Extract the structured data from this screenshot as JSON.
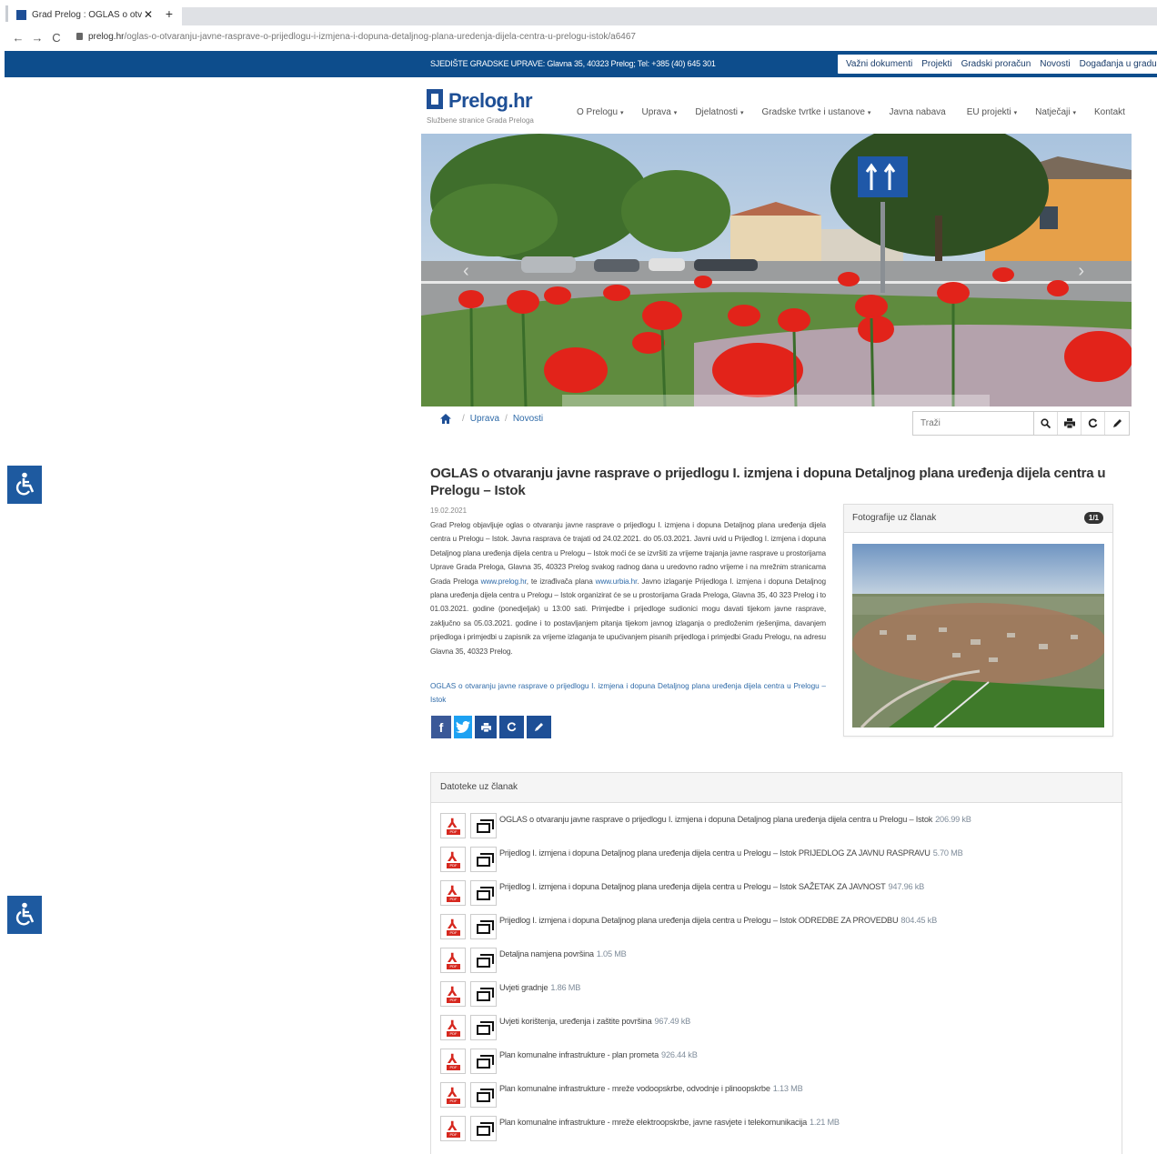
{
  "browser": {
    "tab_title": "Grad Prelog : OGLAS o otvaranju",
    "tab_close": "✕",
    "new_tab": "+",
    "url_host": "prelog.hr",
    "url_path": "/oglas-o-otvaranju-javne-rasprave-o-prijedlogu-i-izmjena-i-dopuna-detaljnog-plana-uredenja-dijela-centra-u-prelogu-istok/a6467"
  },
  "topbar": {
    "seat": "SJEDIŠTE GRADSKE UPRAVE: Glavna 35, 40323 Prelog; Tel: +385 (40) 645 301",
    "links": [
      "Važni dokumenti",
      "Projekti",
      "Gradski proračun",
      "Novosti",
      "Događanja u gradu"
    ]
  },
  "logo": {
    "name": "Prelog.hr",
    "subtitle": "Službene stranice Grada Preloga"
  },
  "nav": [
    {
      "label": "O Prelogu",
      "caret": "▾"
    },
    {
      "label": "Uprava",
      "caret": "▾"
    },
    {
      "label": "Djelatnosti",
      "caret": "▾"
    },
    {
      "label": "Gradske tvrtke i ustanove",
      "caret": "▾"
    },
    {
      "label": "Javna nabava",
      "caret": ""
    },
    {
      "label": "EU projekti",
      "caret": "▾"
    },
    {
      "label": "Natječaji",
      "caret": "▾"
    },
    {
      "label": "Kontakt",
      "caret": ""
    }
  ],
  "breadcrumb": [
    "Uprava",
    "Novosti"
  ],
  "search": {
    "placeholder": "Traži"
  },
  "article": {
    "title": "OGLAS o otvaranju javne rasprave o prijedlogu I. izmjena i dopuna Detaljnog plana uređenja dijela centra u Prelogu – Istok",
    "date": "19.02.2021",
    "body_1": "Grad Prelog objavljuje oglas o otvaranju javne rasprave o prijedlogu I. izmjena i dopuna Detaljnog plana uređenja dijela centra u Prelogu – Istok. Javna rasprava će trajati od 24.02.2021. do 05.03.2021. Javni uvid u Prijedlog I. izmjena i dopuna Detaljnog plana uređenja dijela centra u Prelogu – Istok moći će se izvršiti za vrijeme trajanja javne rasprave u prostorijama Uprave Grada Preloga, Glavna 35, 40323 Prelog svakog radnog dana u uredovno radno vrijeme i na mrežnim stranicama Grada Preloga ",
    "link_1": "www.prelog.hr",
    "body_2": ", te izrađivača plana ",
    "link_2": "www.urbia.hr",
    "body_3": ". Javno izlaganje Prijedloga I. izmjena i dopuna Detaljnog plana uređenja dijela centra u Prelogu – Istok organizirat će se u prostorijama Grada Preloga, Glavna 35, 40 323 Prelog i to 01.03.2021. godine (ponedjeljak) u 13:00 sati. Primjedbe i prijedloge sudionici mogu davati tijekom javne rasprave, zaključno sa 05.03.2021. godine i to postavljanjem pitanja tijekom javnog izlaganja o predloženim rješenjima, davanjem prijedloga i primjedbi u zapisnik za vrijeme izlaganja te upućivanjem pisanih prijedloga i primjedbi Gradu Prelogu, na adresu Glavna 35, 40323 Prelog.",
    "doc_link": "OGLAS o otvaranju javne rasprave o prijedlogu  I. izmjena i dopuna Detaljnog plana uređenja dijela centra u Prelogu – Istok"
  },
  "photos": {
    "heading": "Fotografije uz članak",
    "count": "1/1"
  },
  "files": {
    "heading": "Datoteke uz članak",
    "items": [
      {
        "name": "OGLAS o otvaranju javne rasprave o prijedlogu I. izmjena i dopuna Detaljnog plana uređenja dijela centra u Prelogu – Istok",
        "size": "206.99 kB"
      },
      {
        "name": "Prijedlog I. izmjena i dopuna Detaljnog plana uređenja dijela centra u Prelogu – Istok PRIJEDLOG ZA JAVNU RASPRAVU",
        "size": "5.70 MB"
      },
      {
        "name": "Prijedlog I. izmjena i dopuna Detaljnog plana uređenja dijela centra u Prelogu – Istok SAŽETAK ZA JAVNOST",
        "size": "947.96 kB"
      },
      {
        "name": "Prijedlog I. izmjena i dopuna Detaljnog plana uređenja dijela centra u Prelogu – Istok ODREDBE ZA PROVEDBU",
        "size": "804.45 kB"
      },
      {
        "name": "Detaljna namjena površina",
        "size": "1.05 MB"
      },
      {
        "name": "Uvjeti gradnje",
        "size": "1.86 MB"
      },
      {
        "name": "Uvjeti korištenja, uređenja i zaštite površina",
        "size": "967.49 kB"
      },
      {
        "name": "Plan komunalne infrastrukture - plan prometa",
        "size": "926.44 kB"
      },
      {
        "name": "Plan komunalne infrastrukture - mreže vodoopskrbe, odvodnje i plinoopskrbe",
        "size": "1.13 MB"
      },
      {
        "name": "Plan komunalne infrastrukture - mreže elektroopskrbe, javne rasvjete i telekomunikacija",
        "size": "1.21 MB"
      }
    ]
  },
  "colors": {
    "brand_blue": "#0d4d8c",
    "link": "#2e6aa8",
    "pdf_red": "#d6281f"
  }
}
